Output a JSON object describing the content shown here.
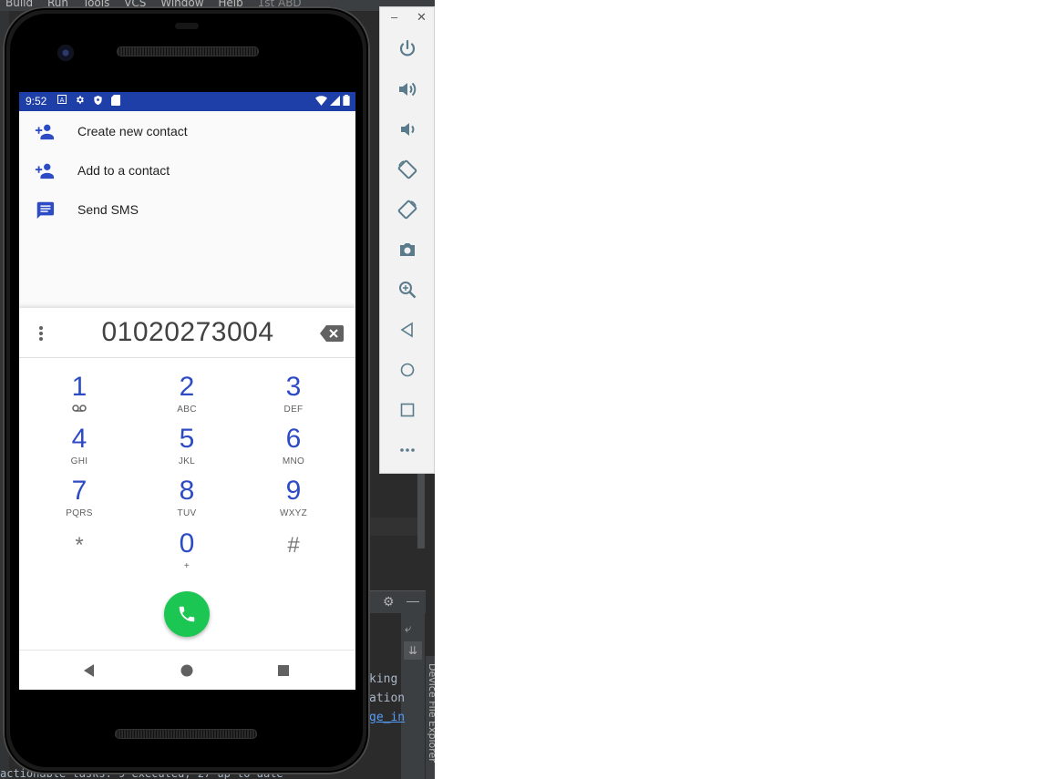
{
  "ide": {
    "menu": [
      "Build",
      "Run",
      "Tools",
      "VCS",
      "Window",
      "Help",
      "1st ABD"
    ],
    "console_lines": [
      "king",
      "ation",
      "ge_in"
    ],
    "bottom_text": "actionable tasks: 9 executed, 27 up-to-date",
    "side_tab": "Device File Explorer"
  },
  "statusbar": {
    "time": "9:52"
  },
  "menu": [
    {
      "label": "Create new contact",
      "icon": "add-person-icon"
    },
    {
      "label": "Add to a contact",
      "icon": "add-person-icon"
    },
    {
      "label": "Send SMS",
      "icon": "message-icon"
    }
  ],
  "dialer": {
    "number": "01020273004",
    "keys": [
      {
        "digit": "1",
        "letters": "ꝏ"
      },
      {
        "digit": "2",
        "letters": "ABC"
      },
      {
        "digit": "3",
        "letters": "DEF"
      },
      {
        "digit": "4",
        "letters": "GHI"
      },
      {
        "digit": "5",
        "letters": "JKL"
      },
      {
        "digit": "6",
        "letters": "MNO"
      },
      {
        "digit": "7",
        "letters": "PQRS"
      },
      {
        "digit": "8",
        "letters": "TUV"
      },
      {
        "digit": "9",
        "letters": "WXYZ"
      },
      {
        "digit": "*",
        "letters": ""
      },
      {
        "digit": "0",
        "letters": "+"
      },
      {
        "digit": "#",
        "letters": ""
      }
    ]
  },
  "colors": {
    "statusbar": "#1e3fa8",
    "accent": "#2c4bc4",
    "call": "#1bc653"
  },
  "emulator_controls": [
    "power",
    "volume-up",
    "volume-down",
    "rotate-left",
    "rotate-right",
    "screenshot",
    "zoom",
    "back",
    "home",
    "overview",
    "more"
  ]
}
